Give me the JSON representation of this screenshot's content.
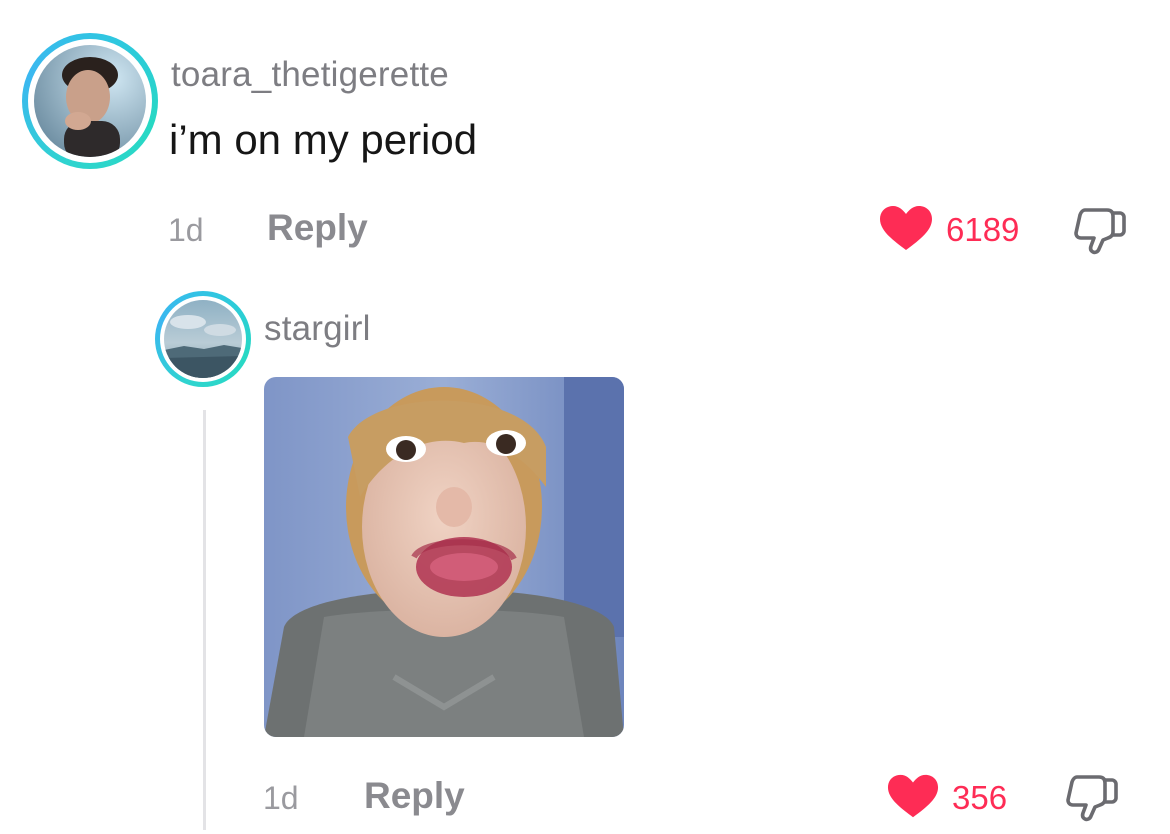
{
  "comment": {
    "username": "toara_thetigerette",
    "text": "i’m on my period",
    "time": "1d",
    "reply_label": "Reply",
    "likes": "6189",
    "avatar": "avatar-photo"
  },
  "reply": {
    "username": "stargirl",
    "image": "reaction-meme-photo",
    "time": "1d",
    "reply_label": "Reply",
    "likes": "356",
    "avatar": "sky-landscape-photo"
  },
  "colors": {
    "accent": "#fe2c55",
    "ring": "#2fd4cf",
    "meta": "#8a8a8f"
  },
  "icons": [
    "heart-icon",
    "dislike-icon"
  ]
}
